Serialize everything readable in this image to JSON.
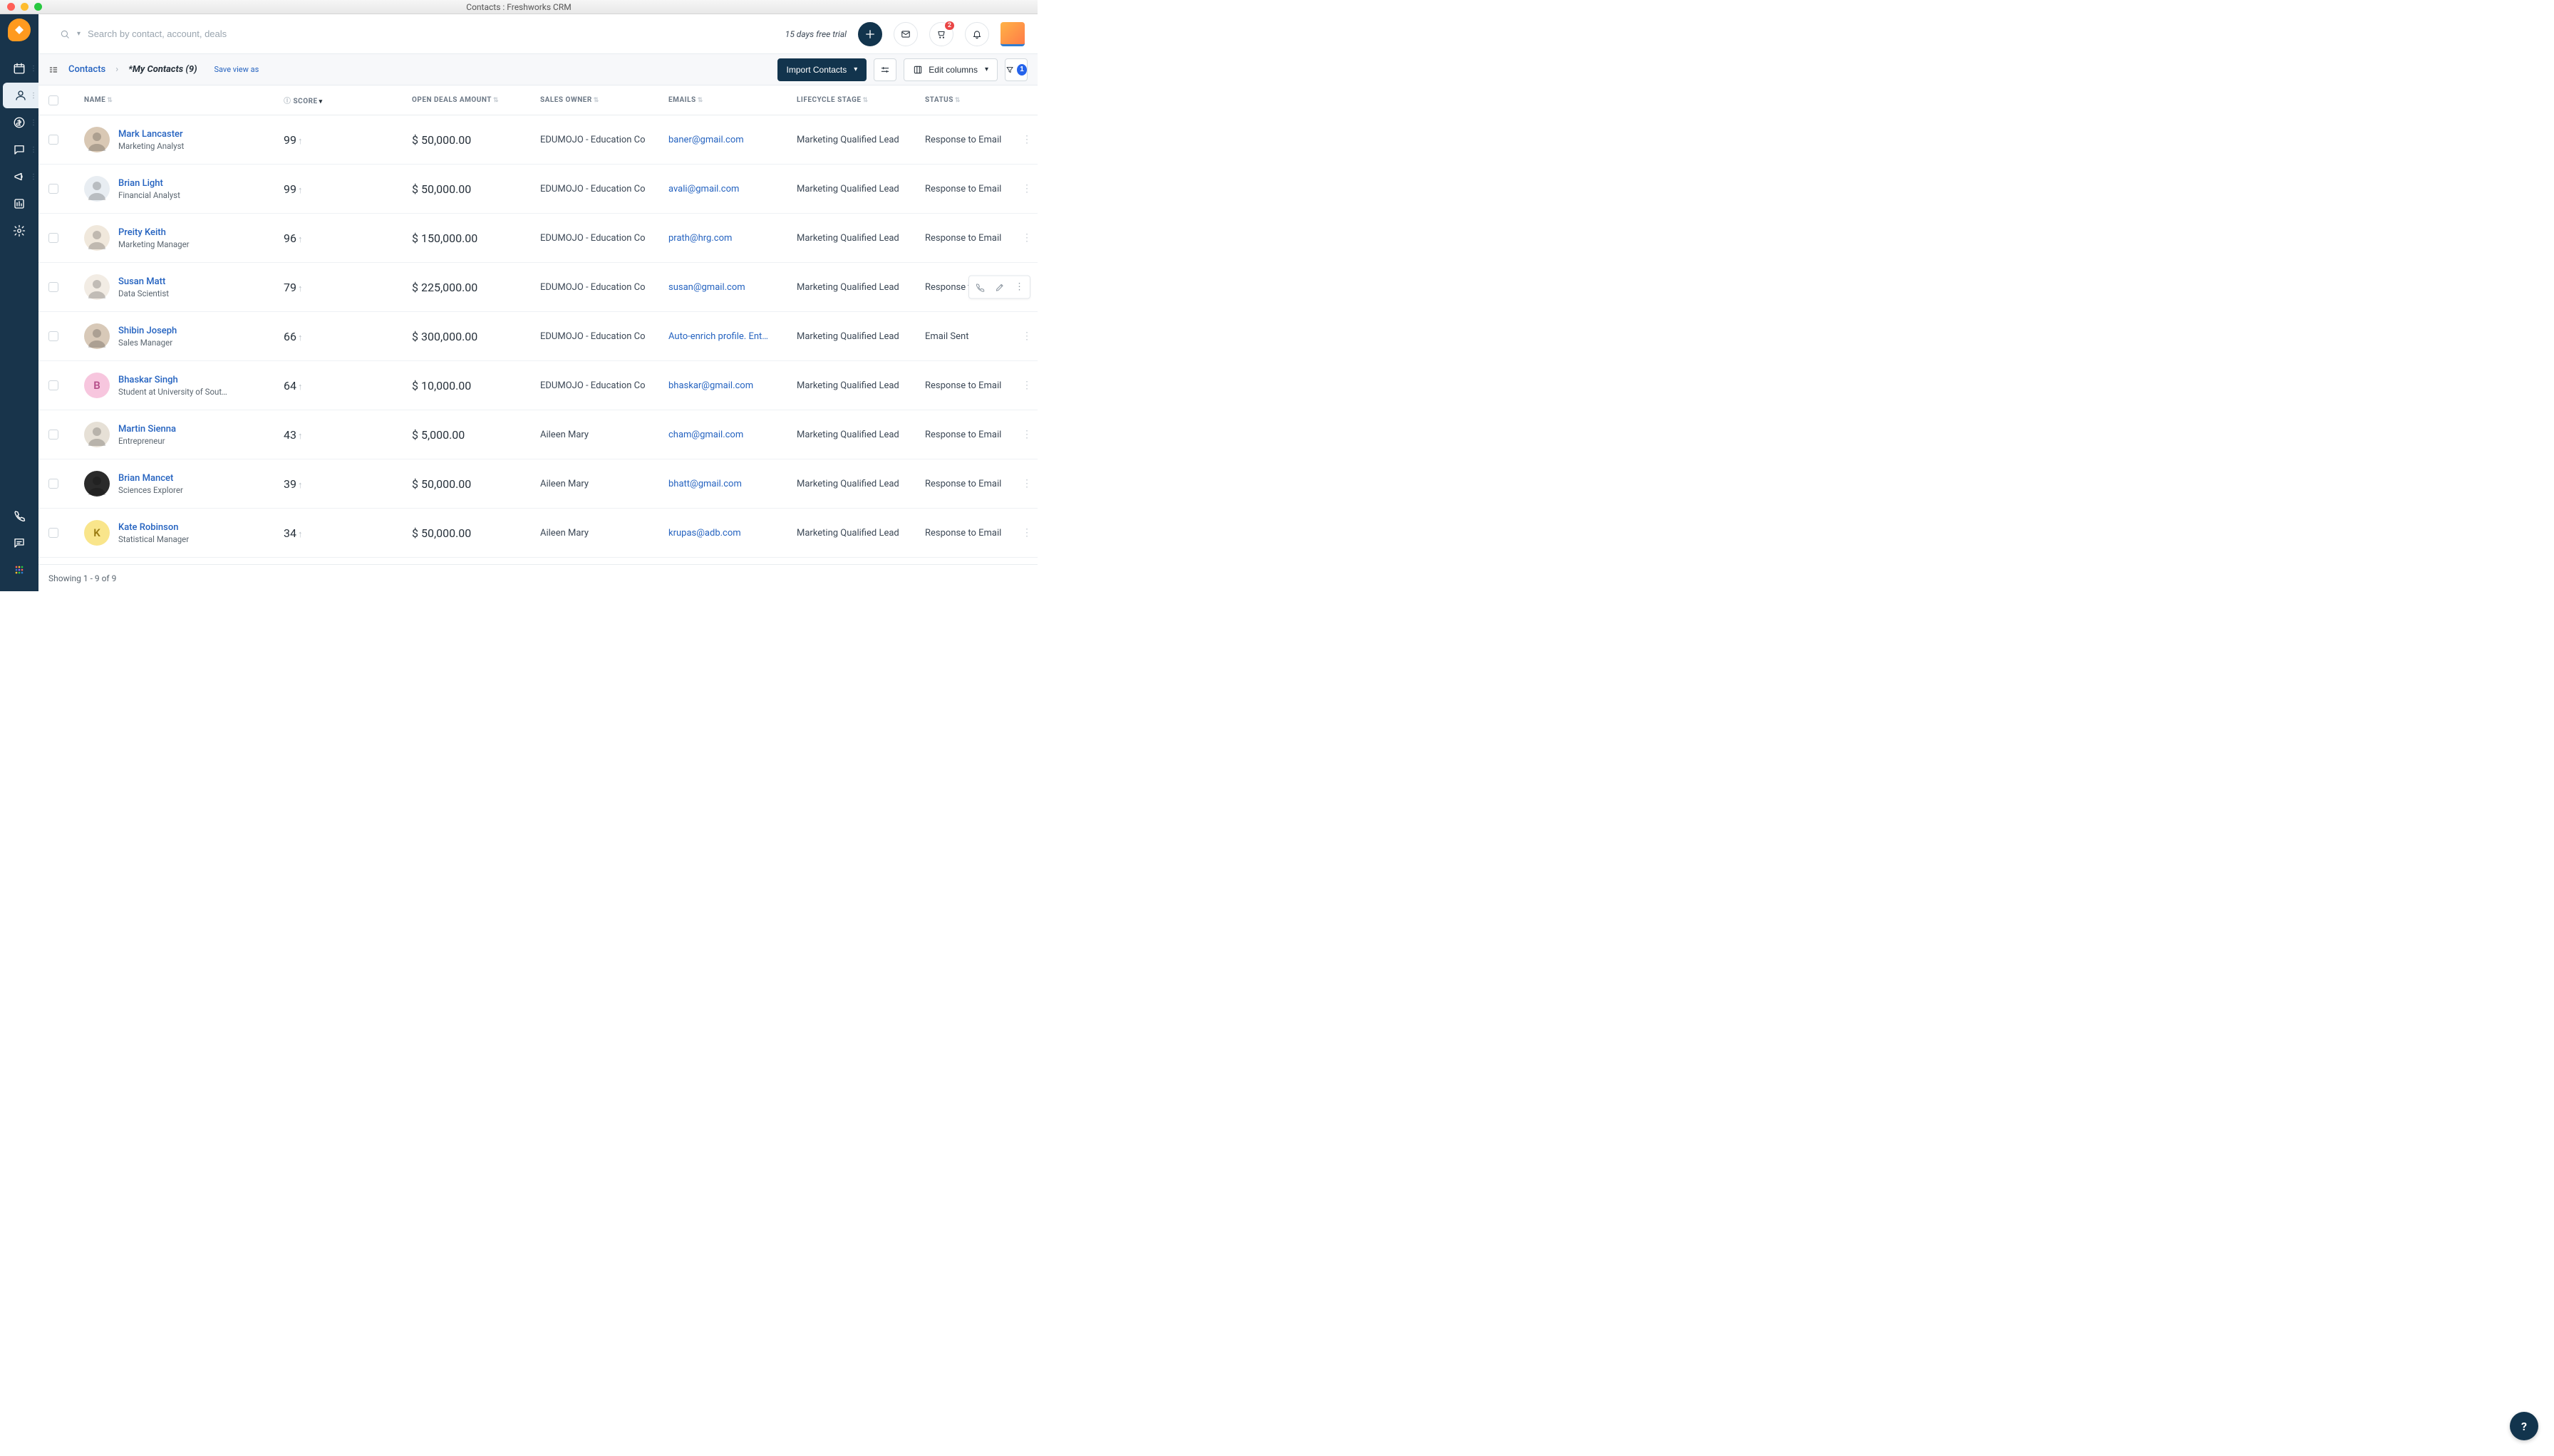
{
  "window": {
    "title": "Contacts : Freshworks CRM"
  },
  "header": {
    "search_placeholder": "Search by contact, account, deals",
    "trial_text": "15 days free trial",
    "cart_badge": "2"
  },
  "breadcrumb": {
    "root": "Contacts",
    "current": "*My Contacts  (9)",
    "save_view": "Save view as"
  },
  "toolbar": {
    "import_label": "Import Contacts",
    "edit_columns": "Edit columns",
    "filter_count": "1"
  },
  "columns": {
    "name": "NAME",
    "score": "SCORE",
    "amount": "OPEN DEALS AMOUNT",
    "owner": "SALES OWNER",
    "email": "EMAILS",
    "stage": "LIFECYCLE STAGE",
    "status": "STATUS"
  },
  "rows": [
    {
      "name": "Mark Lancaster",
      "title": "Marketing Analyst",
      "score": "99",
      "amount": "$ 50,000.00",
      "owner": "EDUMOJO - Education Co",
      "email": "baner@gmail.com",
      "stage": "Marketing Qualified Lead",
      "status": "Response to Email",
      "avatar_bg": "#d9c8b4",
      "avatar_letter": ""
    },
    {
      "name": "Brian Light",
      "title": "Financial Analyst",
      "score": "99",
      "amount": "$ 50,000.00",
      "owner": "EDUMOJO - Education Co",
      "email": "avali@gmail.com",
      "stage": "Marketing Qualified Lead",
      "status": "Response to Email",
      "avatar_bg": "#e8edf2",
      "avatar_letter": ""
    },
    {
      "name": "Preity Keith",
      "title": "Marketing Manager",
      "score": "96",
      "amount": "$ 150,000.00",
      "owner": "EDUMOJO - Education Co",
      "email": "prath@hrg.com",
      "stage": "Marketing Qualified Lead",
      "status": "Response to Email",
      "avatar_bg": "#f0e8dc",
      "avatar_letter": ""
    },
    {
      "name": "Susan Matt",
      "title": "Data Scientist",
      "score": "79",
      "amount": "$ 225,000.00",
      "owner": "EDUMOJO - Education Co",
      "email": "susan@gmail.com",
      "stage": "Marketing Qualified Lead",
      "status": "Response to Email",
      "avatar_bg": "#f2ece4",
      "avatar_letter": "",
      "hover": true
    },
    {
      "name": "Shibin Joseph",
      "title": "Sales Manager",
      "score": "66",
      "amount": "$ 300,000.00",
      "owner": "EDUMOJO - Education Co",
      "email": "Auto-enrich profile. Ent…",
      "stage": "Marketing Qualified Lead",
      "status": "Email Sent",
      "avatar_bg": "#d8c9b8",
      "avatar_letter": ""
    },
    {
      "name": "Bhaskar Singh",
      "title": "Student at University of Sout…",
      "score": "64",
      "amount": "$ 10,000.00",
      "owner": "EDUMOJO - Education Co",
      "email": "bhaskar@gmail.com",
      "stage": "Marketing Qualified Lead",
      "status": "Response to Email",
      "avatar_bg": "#f7c6de",
      "avatar_letter": "B"
    },
    {
      "name": "Martin Sienna",
      "title": "Entrepreneur",
      "score": "43",
      "amount": "$ 5,000.00",
      "owner": "Aileen Mary",
      "email": "cham@gmail.com",
      "stage": "Marketing Qualified Lead",
      "status": "Response to Email",
      "avatar_bg": "#e6e0d6",
      "avatar_letter": ""
    },
    {
      "name": "Brian Mancet",
      "title": "Sciences Explorer",
      "score": "39",
      "amount": "$ 50,000.00",
      "owner": "Aileen Mary",
      "email": "bhatt@gmail.com",
      "stage": "Marketing Qualified Lead",
      "status": "Response to Email",
      "avatar_bg": "#2b2b2b",
      "avatar_letter": ""
    },
    {
      "name": "Kate Robinson",
      "title": "Statistical Manager",
      "score": "34",
      "amount": "$ 50,000.00",
      "owner": "Aileen Mary",
      "email": "krupas@adb.com",
      "stage": "Marketing Qualified Lead",
      "status": "Response to Email",
      "avatar_bg": "#f9e58b",
      "avatar_letter": "K"
    }
  ],
  "footer": {
    "showing": "Showing 1 - 9 of 9"
  }
}
